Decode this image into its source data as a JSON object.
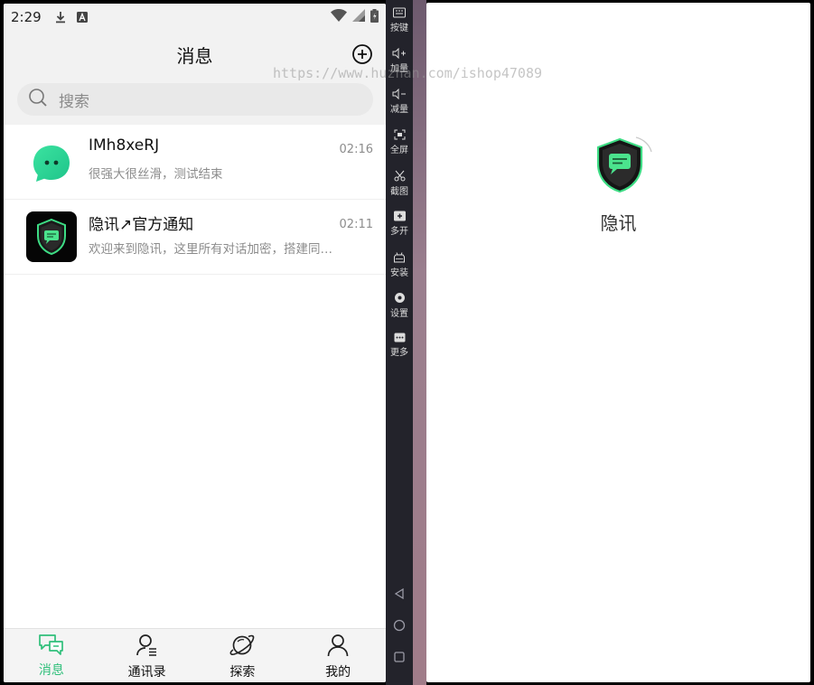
{
  "status_bar": {
    "time": "2:29"
  },
  "header": {
    "title": "消息"
  },
  "search": {
    "placeholder": "搜索"
  },
  "conversations": [
    {
      "name": "IMh8xeRJ",
      "message": "很强大很丝滑，测试结束",
      "time": "02:16",
      "avatar_color": "#2fd39a"
    },
    {
      "name": "隐讯↗官方通知",
      "message": "欢迎来到隐讯，这里所有对话加密，搭建同…",
      "time": "02:11",
      "avatar_color": "#000000"
    }
  ],
  "tabs": [
    {
      "label": "消息",
      "icon": "chat-icon",
      "active": true
    },
    {
      "label": "通讯录",
      "icon": "contacts-icon",
      "active": false
    },
    {
      "label": "探索",
      "icon": "planet-icon",
      "active": false
    },
    {
      "label": "我的",
      "icon": "person-icon",
      "active": false
    }
  ],
  "emulator_toolbar": [
    {
      "label": "按键",
      "icon": "keyboard-icon"
    },
    {
      "label": "加量",
      "icon": "volume-up-icon"
    },
    {
      "label": "减量",
      "icon": "volume-down-icon"
    },
    {
      "label": "全屏",
      "icon": "fullscreen-icon"
    },
    {
      "label": "截图",
      "icon": "scissors-icon"
    },
    {
      "label": "多开",
      "icon": "multi-instance-icon"
    },
    {
      "label": "安装",
      "icon": "apk-install-icon"
    },
    {
      "label": "设置",
      "icon": "settings-icon"
    },
    {
      "label": "更多",
      "icon": "more-icon"
    }
  ],
  "splash": {
    "app_name": "隐讯"
  },
  "watermark": "https://www.huzhan.com/ishop47089",
  "colors": {
    "accent": "#2fbf7a",
    "shield_green": "#3ddc84",
    "toolbar_bg": "#23232b"
  }
}
